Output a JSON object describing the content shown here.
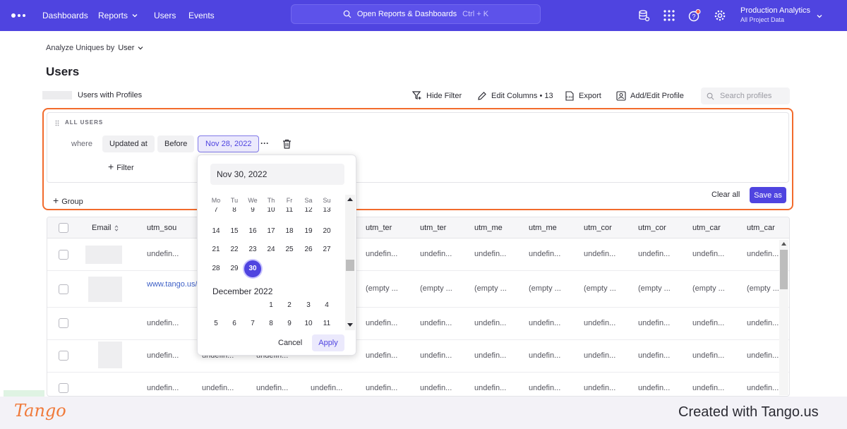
{
  "nav": {
    "items": [
      "Dashboards",
      "Reports",
      "Users",
      "Events"
    ],
    "search_label": "Open Reports & Dashboards",
    "search_shortcut": "Ctrl + K",
    "project_name": "Production Analytics",
    "project_sub": "All Project Data"
  },
  "page": {
    "analyze_label": "Analyze Uniques by",
    "analyze_value": "User",
    "title": "Users",
    "users_with_profiles": "Users with Profiles"
  },
  "toolbar": {
    "hide_filter": "Hide Filter",
    "edit_columns": "Edit Columns • 13",
    "export": "Export",
    "add_edit_profile": "Add/Edit Profile",
    "search_placeholder": "Search profiles"
  },
  "filter": {
    "section": "ALL USERS",
    "where": "where",
    "property": "Updated at",
    "operator": "Before",
    "value": "Nov 28, 2022",
    "more": "···",
    "add_filter": "Filter",
    "add_group": "Group",
    "clear_all": "Clear all",
    "save_as": "Save as"
  },
  "table": {
    "headers": [
      "Email",
      "utm_sou",
      "utm_ter",
      "utm_ter",
      "utm_me",
      "utm_me",
      "utm_cor",
      "utm_cor",
      "utm_car",
      "utm_car"
    ],
    "rows": [
      {
        "c1": "undefin...",
        "rest": [
          "undefin...",
          "undefin...",
          "undefin...",
          "undefin...",
          "undefin...",
          "undefin...",
          "undefin...",
          "undefin..."
        ]
      },
      {
        "c1": "www.tango.us/",
        "rest": [
          "(empty ...",
          "(empty ...",
          "(empty ...",
          "(empty ...",
          "(empty ...",
          "(empty ...",
          "(empty ...",
          "(empty ..."
        ]
      },
      {
        "c1": "undefin...",
        "rest": [
          "undefin...",
          "undefin...",
          "undefin...",
          "undefin...",
          "undefin...",
          "undefin...",
          "undefin...",
          "undefin..."
        ]
      },
      {
        "c1": "undefin...",
        "c2": "undefin...",
        "c3": "undefin...",
        "rest": [
          "undefin...",
          "undefin...",
          "undefin...",
          "undefin...",
          "undefin...",
          "undefin...",
          "undefin...",
          "undefin..."
        ]
      },
      {
        "c1": "undefin...",
        "c2": "undefin...",
        "c3": "undefin...",
        "c4": "undefin...",
        "rest": [
          "undefin...",
          "undefin...",
          "undefin...",
          "undefin...",
          "undefin...",
          "undefin...",
          "undefin...",
          "undefin..."
        ]
      }
    ]
  },
  "datepicker": {
    "input_value": "Nov 30, 2022",
    "weekdays": [
      "Mo",
      "Tu",
      "We",
      "Th",
      "Fr",
      "Sa",
      "Su"
    ],
    "nov_rows": [
      [
        "7",
        "8",
        "9",
        "10",
        "11",
        "12",
        "13"
      ],
      [
        "14",
        "15",
        "16",
        "17",
        "18",
        "19",
        "20"
      ],
      [
        "21",
        "22",
        "23",
        "24",
        "25",
        "26",
        "27"
      ],
      [
        "28",
        "29",
        "30"
      ]
    ],
    "selected_day": "30",
    "next_month": "December 2022",
    "dec_rows": [
      [
        "",
        "",
        "",
        "1",
        "2",
        "3",
        "4"
      ],
      [
        "5",
        "6",
        "7",
        "8",
        "9",
        "10",
        "11"
      ]
    ],
    "cancel": "Cancel",
    "apply": "Apply"
  },
  "footer": {
    "brand": "Tango",
    "created": "Created with Tango.us"
  }
}
